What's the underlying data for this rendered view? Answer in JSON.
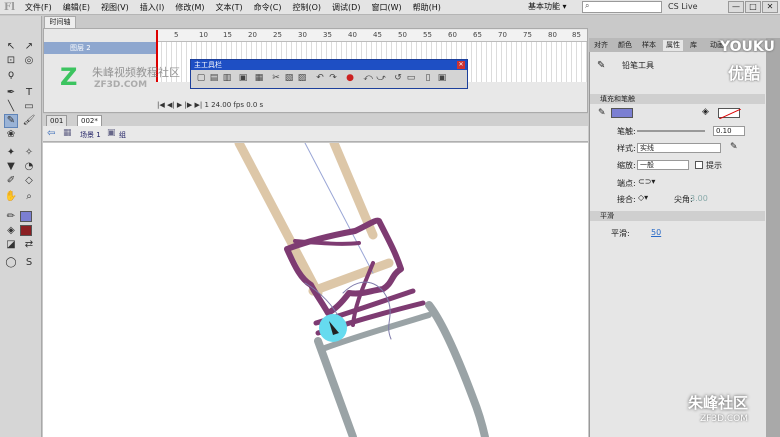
{
  "app": {
    "logo": "Fl"
  },
  "menu": [
    "文件(F)",
    "编辑(E)",
    "视图(V)",
    "插入(I)",
    "修改(M)",
    "文本(T)",
    "命令(C)",
    "控制(O)",
    "调试(D)",
    "窗口(W)",
    "帮助(H)"
  ],
  "header": {
    "workspace": "基本功能 ▾",
    "search_icon": "search-icon",
    "cs_live": "CS Live",
    "window_buttons": [
      "—",
      "□",
      "✕"
    ]
  },
  "timeline": {
    "tab": "时间轴",
    "layer": "图层 2",
    "ruler": [
      "5",
      "10",
      "15",
      "20",
      "25",
      "30",
      "35",
      "40",
      "45",
      "50",
      "55",
      "60",
      "65",
      "70",
      "75",
      "80",
      "85"
    ],
    "controls": "|◀ ◀| ▶ |▶ ▶|     1    24.00 fps   0.0 s"
  },
  "toolbar_window": {
    "title": "主工具栏",
    "close": "✕",
    "icons": [
      "▢",
      "▤",
      "▥",
      "▣",
      "▦",
      "✂",
      "▧",
      "▨",
      "↶",
      "↷",
      "●",
      "⤺",
      "⤻",
      "↺",
      "▭",
      "▯",
      "▣"
    ]
  },
  "watermark": {
    "logo": "Z",
    "text": "朱峰视频教程社区",
    "url": "ZF3D.COM"
  },
  "doc_tabs": [
    "001",
    "002*"
  ],
  "edit_bar": {
    "scene": "场景 1",
    "symbol": "组"
  },
  "panel": {
    "tabs": [
      "对齐",
      "颜色",
      "样本",
      "属性",
      "库",
      "动画"
    ],
    "tool_name": "铅笔工具",
    "section_fill": "填充和笔触",
    "stroke_label": "笔触:",
    "stroke_value": "0.10",
    "style_label": "样式:",
    "style_value": "实线",
    "scale_label": "缩放:",
    "scale_value": "一般",
    "hint_label": "提示",
    "cap_label": "端点:",
    "join_label": "接合:",
    "miter_label": "尖角:",
    "miter_value": "3.00",
    "section_smooth": "平滑",
    "smooth_label": "平滑:",
    "smooth_value": "50"
  },
  "overlay": {
    "youku": "YOUKU",
    "youku2": "优酷",
    "brand": "朱峰社区",
    "brand_url": "ZF3D.COM"
  },
  "colors": {
    "stroke": "#7b7fd2",
    "fill": "#8b1f23"
  }
}
